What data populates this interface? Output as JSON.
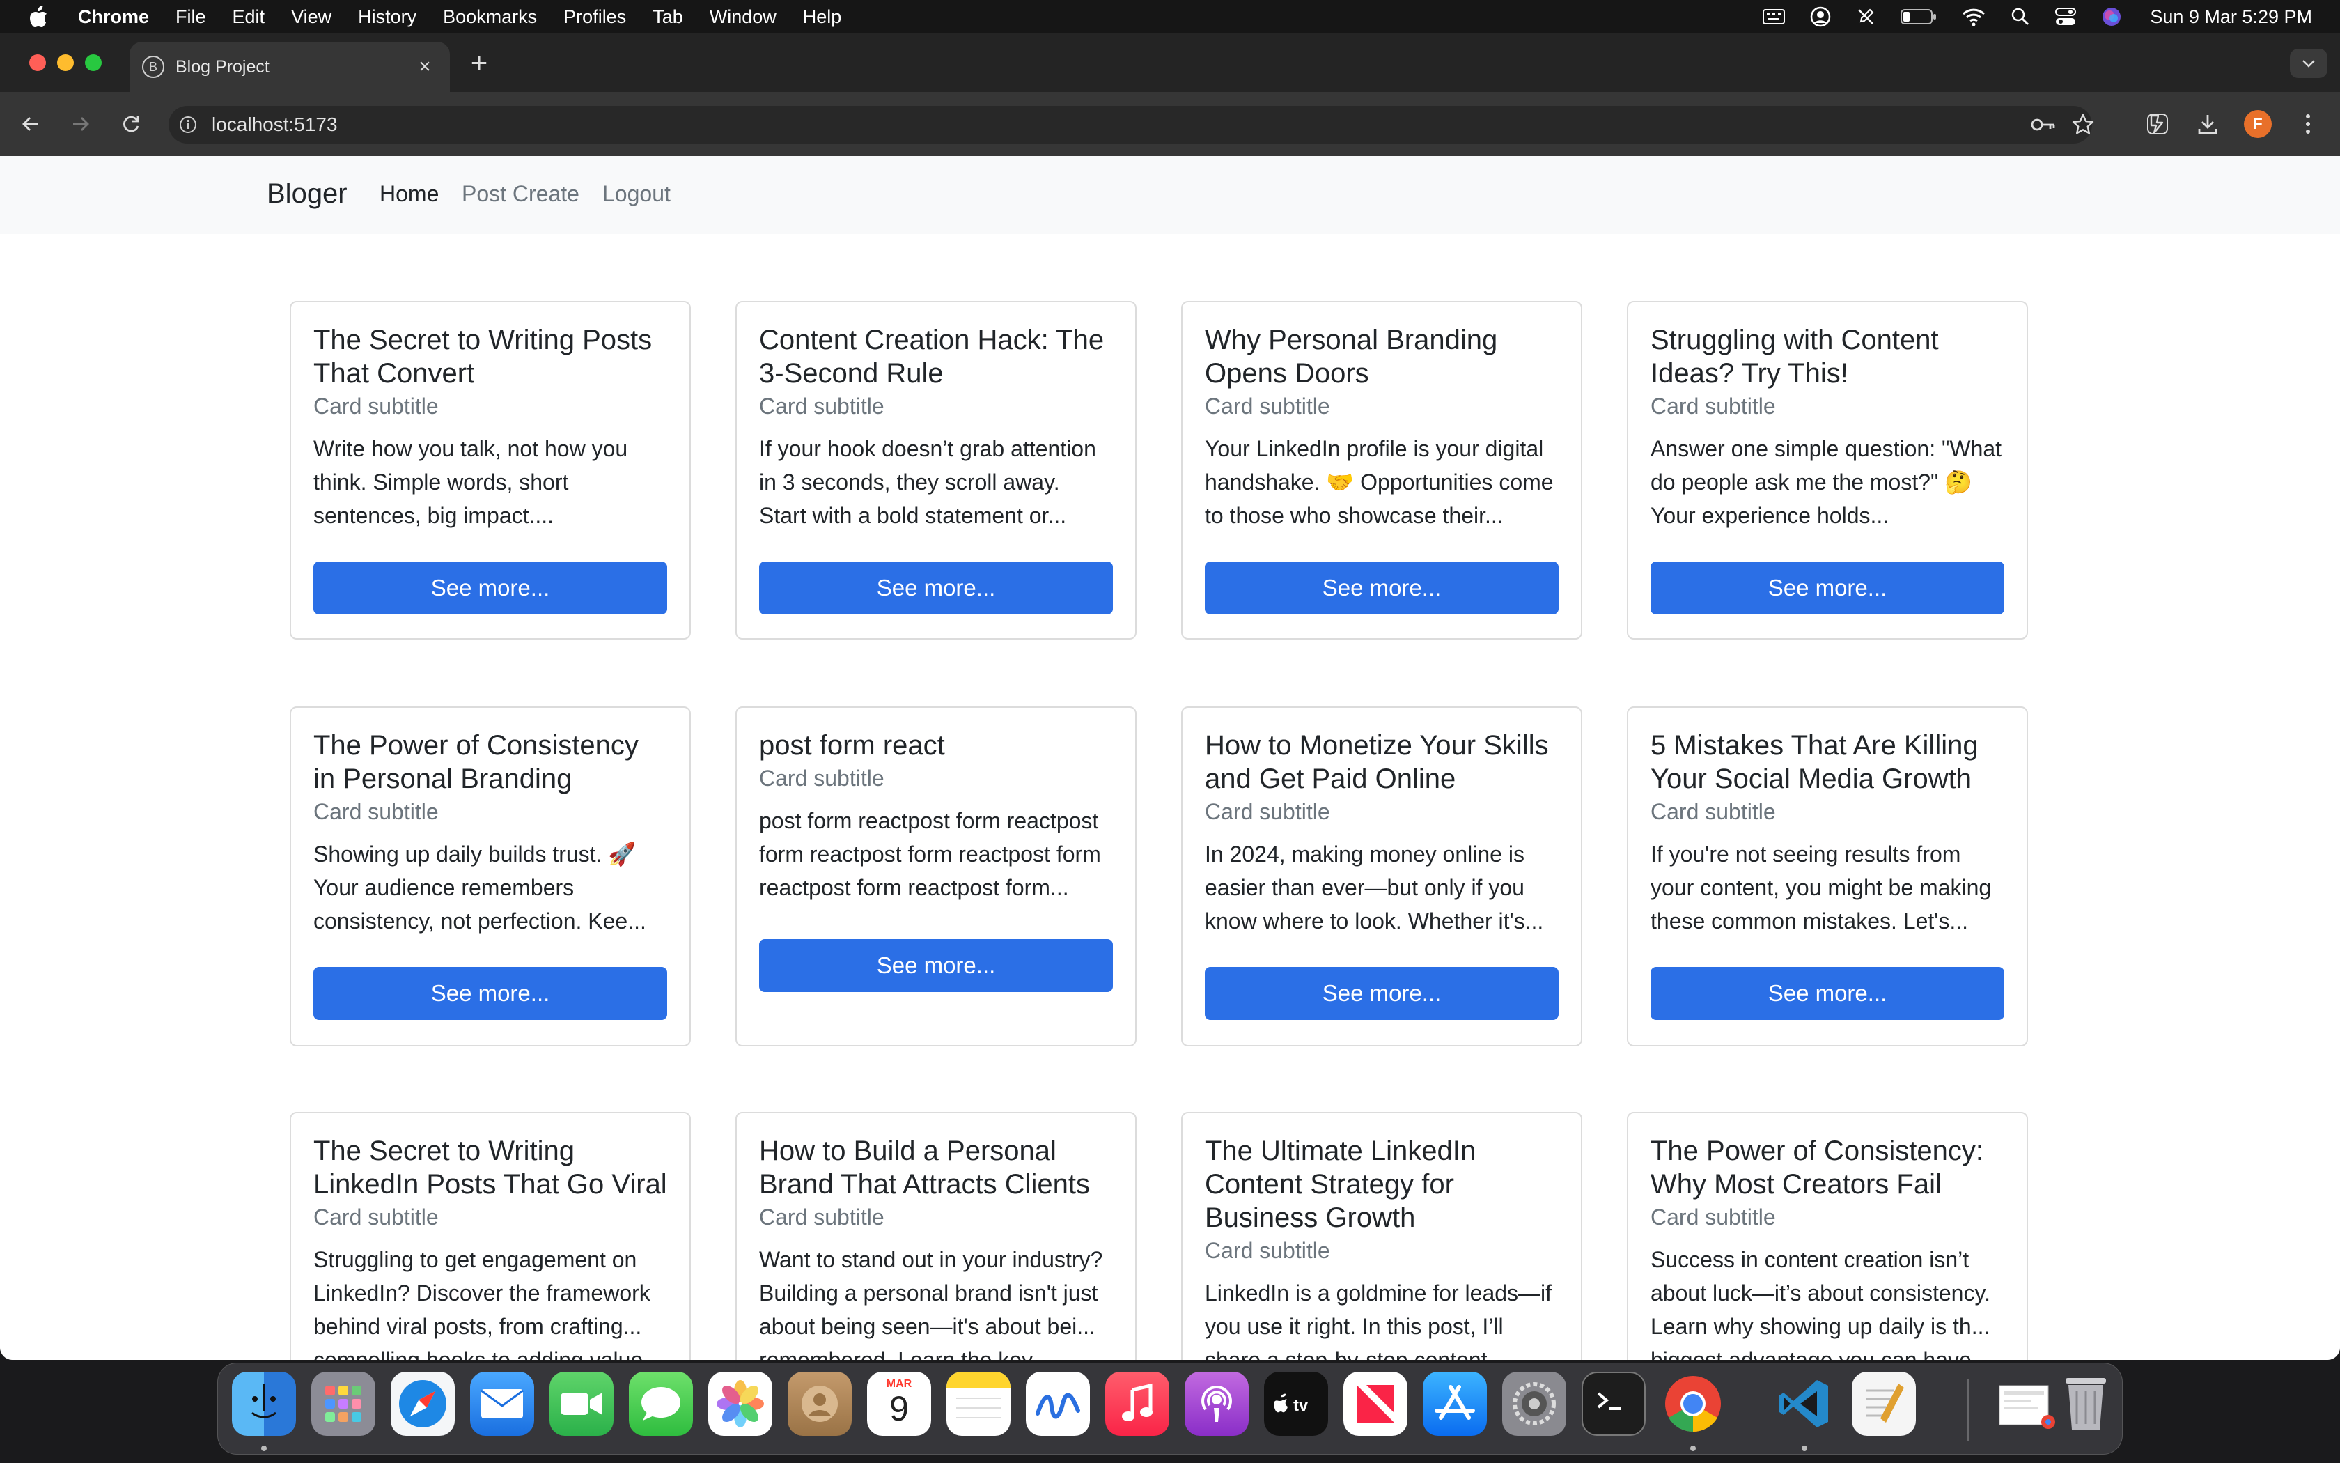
{
  "menubar": {
    "app": "Chrome",
    "items": [
      "File",
      "Edit",
      "View",
      "History",
      "Bookmarks",
      "Profiles",
      "Tab",
      "Window",
      "Help"
    ],
    "clock": "Sun 9 Mar  5:29 PM"
  },
  "browser": {
    "tab_title": "Blog Project",
    "tab_favicon_letter": "B",
    "url": "localhost:5173",
    "profile_initial": "F"
  },
  "page": {
    "brand": "Bloger",
    "nav": [
      "Home",
      "Post Create",
      "Logout"
    ],
    "active_nav": "Home",
    "button_label": "See more...",
    "cards": [
      {
        "title": "The Secret to Writing Posts That Convert",
        "subtitle": "Card subtitle",
        "text": "Write how you talk, not how you think. Simple words, short sentences, big impact...."
      },
      {
        "title": "Content Creation Hack: The 3-Second Rule",
        "subtitle": "Card subtitle",
        "text": "If your hook doesn’t grab attention in 3 seconds, they scroll away. Start with a bold statement or..."
      },
      {
        "title": "Why Personal Branding Opens Doors",
        "subtitle": "Card subtitle",
        "text": "Your LinkedIn profile is your digital handshake. 🤝 Opportunities come to those who showcase their..."
      },
      {
        "title": "Struggling with Content Ideas? Try This!",
        "subtitle": "Card subtitle",
        "text": "Answer one simple question: \"What do people ask me the most?\" 🤔 Your experience holds..."
      },
      {
        "title": "The Power of Consistency in Personal Branding",
        "subtitle": "Card subtitle",
        "text": "Showing up daily builds trust. 🚀 Your audience remembers consistency, not perfection. Kee..."
      },
      {
        "title": "post form react",
        "subtitle": "Card subtitle",
        "text": "post form reactpost form reactpost form reactpost form reactpost form reactpost form reactpost form..."
      },
      {
        "title": "How to Monetize Your Skills and Get Paid Online",
        "subtitle": "Card subtitle",
        "text": "In 2024, making money online is easier than ever—but only if you know where to look. Whether it's..."
      },
      {
        "title": "5 Mistakes That Are Killing Your Social Media Growth",
        "subtitle": "Card subtitle",
        "text": "If you're not seeing results from your content, you might be making these common mistakes. Let's..."
      },
      {
        "title": "The Secret to Writing LinkedIn Posts That Go Viral",
        "subtitle": "Card subtitle",
        "text": "Struggling to get engagement on LinkedIn? Discover the framework behind viral posts, from crafting... compelling hooks to adding value"
      },
      {
        "title": "How to Build a Personal Brand That Attracts Clients",
        "subtitle": "Card subtitle",
        "text": "Want to stand out in your industry? Building a personal brand isn't just about being seen—it's about bei... remembered. Learn the key"
      },
      {
        "title": "The Ultimate LinkedIn Content Strategy for Business Growth",
        "subtitle": "Card subtitle",
        "text": "LinkedIn is a goldmine for leads—if you use it right. In this post, I’ll share a step-by-step content..."
      },
      {
        "title": "The Power of Consistency: Why Most Creators Fail",
        "subtitle": "Card subtitle",
        "text": "Success in content creation isn’t about luck—it’s about consistency. Learn why showing up daily is th... biggest advantage you can have"
      }
    ]
  },
  "dock": {
    "calendar_month": "MAR",
    "calendar_day": "9",
    "apps": [
      "finder-icon",
      "launchpad-icon",
      "safari-icon",
      "mail-icon",
      "facetime-icon",
      "messages-icon",
      "photos-icon",
      "contacts-icon",
      "calendar-icon",
      "notes-icon",
      "freeform-icon",
      "music-icon",
      "podcasts-icon",
      "tv-icon",
      "news-icon",
      "app-store-icon",
      "system-settings-icon",
      "terminal-icon",
      "chrome-icon",
      "vscode-icon",
      "textedit-icon",
      "preview-icon",
      "trash-icon"
    ]
  },
  "colors": {
    "accent": "#2b6fe6",
    "navbar_bg": "#f8f9fa",
    "card_border": "#dcdcdc",
    "muted": "#6c757d"
  }
}
